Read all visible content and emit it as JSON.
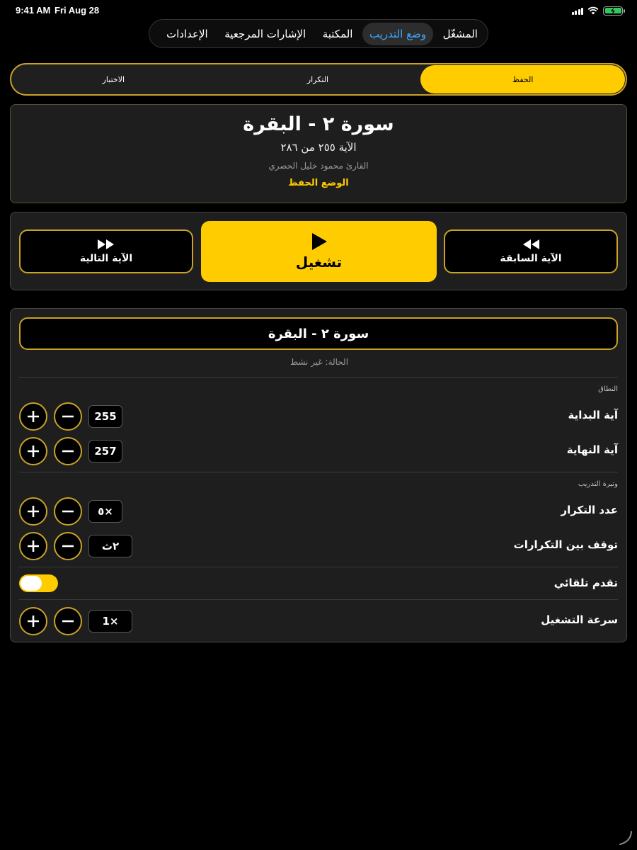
{
  "status_bar": {
    "time": "9:41 AM",
    "date": "Fri Aug 28"
  },
  "top_tabs": [
    {
      "label": "المشغّل",
      "active": false
    },
    {
      "label": "وضع التدريب",
      "active": true
    },
    {
      "label": "المكتبة",
      "active": false
    },
    {
      "label": "الإشارات المرجعية",
      "active": false
    },
    {
      "label": "الإعدادات",
      "active": false
    }
  ],
  "modes": [
    {
      "label": "الحفظ",
      "active": true
    },
    {
      "label": "التكرار",
      "active": false
    },
    {
      "label": "الاختبار",
      "active": false
    }
  ],
  "info": {
    "surah_title": "سورة ٢ - البقرة",
    "ayah": "الآية ٢٥٥ من ٢٨٦",
    "reader": "القارئ محمود خليل الحصري",
    "mode": "الوضع الحفظ"
  },
  "controls": {
    "prev_label": "الآية السابقة",
    "play_label": "تشغيل",
    "next_label": "الآية التالية"
  },
  "settings": {
    "surah": "سورة ٢ - البقرة",
    "status": "الحالة: غير نشط",
    "range_section": "النطاق",
    "start_label": "آية البداية",
    "start_value": "255",
    "end_label": "آية النهاية",
    "end_value": "257",
    "pace_section": "وتيرة التدريب",
    "repeat_label": "عدد التكرار",
    "repeat_value": "٥×",
    "pause_label": "توقف بين التكرارات",
    "pause_value": "٢ث",
    "auto_label": "تقدم تلقائي",
    "auto_enabled": true,
    "speed_label": "سرعة التشغيل",
    "speed_value": "1×"
  },
  "colors": {
    "accent": "#ffcc00",
    "border_gold": "#c9a227",
    "tab_active": "#3ba7ff"
  }
}
